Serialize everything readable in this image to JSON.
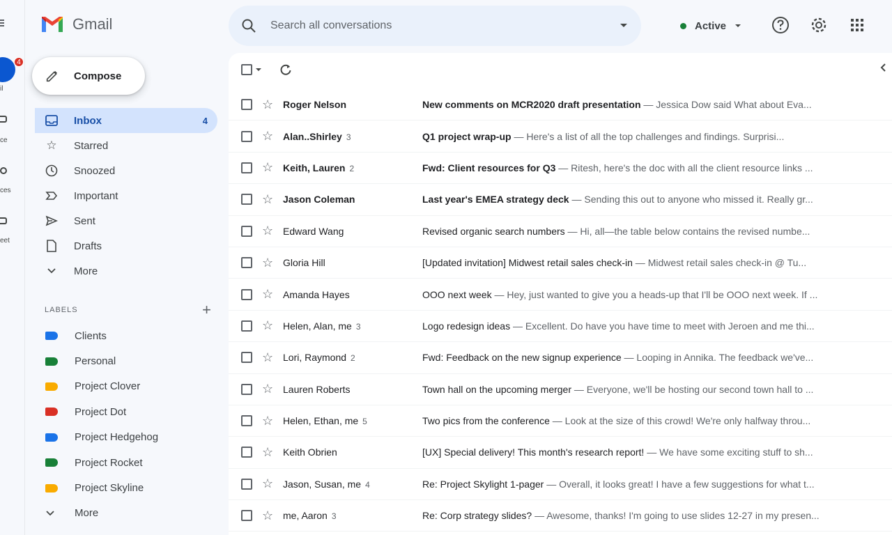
{
  "app": {
    "name": "Gmail"
  },
  "rail": {
    "badge": "4",
    "labels": [
      "il",
      "ce",
      "ces",
      "eet"
    ]
  },
  "compose": {
    "label": "Compose"
  },
  "nav": [
    {
      "label": "Inbox",
      "icon": "inbox-icon",
      "count": "4",
      "active": true
    },
    {
      "label": "Starred",
      "icon": "star-icon"
    },
    {
      "label": "Snoozed",
      "icon": "clock-icon"
    },
    {
      "label": "Important",
      "icon": "important-icon"
    },
    {
      "label": "Sent",
      "icon": "send-icon"
    },
    {
      "label": "Drafts",
      "icon": "draft-icon"
    },
    {
      "label": "More",
      "icon": "chevron-down-icon"
    }
  ],
  "labels_section": {
    "title": "LABELS",
    "items": [
      {
        "label": "Clients",
        "color": "#1a73e8"
      },
      {
        "label": "Personal",
        "color": "#188038"
      },
      {
        "label": "Project Clover",
        "color": "#f9ab00"
      },
      {
        "label": "Project Dot",
        "color": "#d93025"
      },
      {
        "label": "Project Hedgehog",
        "color": "#1a73e8"
      },
      {
        "label": "Project Rocket",
        "color": "#188038"
      },
      {
        "label": "Project Skyline",
        "color": "#f9ab00"
      },
      {
        "label": "More",
        "color": ""
      }
    ]
  },
  "search": {
    "placeholder": "Search all conversations"
  },
  "status": {
    "label": "Active"
  },
  "emails": [
    {
      "sender": "Roger Nelson",
      "count": "",
      "subject": "New comments on MCR2020 draft presentation",
      "snippet": " — Jessica Dow said What about Eva...",
      "unread": true
    },
    {
      "sender": "Alan..Shirley",
      "count": "3",
      "subject": "Q1 project wrap-up",
      "snippet": " — Here's a list of all the top challenges and findings. Surprisi...",
      "unread": true
    },
    {
      "sender": "Keith, Lauren",
      "count": "2",
      "subject": "Fwd: Client resources for Q3",
      "snippet": " — Ritesh, here's the doc with all the client resource links ...",
      "unread": true
    },
    {
      "sender": "Jason Coleman",
      "count": "",
      "subject": "Last year's EMEA strategy deck",
      "snippet": " — Sending this out to anyone who missed it. Really gr...",
      "unread": true
    },
    {
      "sender": "Edward Wang",
      "count": "",
      "subject": "Revised organic search numbers",
      "snippet": " — Hi, all—the table below contains the revised numbe...",
      "unread": false
    },
    {
      "sender": "Gloria Hill",
      "count": "",
      "subject": "[Updated invitation] Midwest retail sales check-in",
      "snippet": " — Midwest retail sales check-in @ Tu...",
      "unread": false
    },
    {
      "sender": "Amanda Hayes",
      "count": "",
      "subject": "OOO next week",
      "snippet": " — Hey, just wanted to give you a heads-up that I'll be OOO next week. If ...",
      "unread": false
    },
    {
      "sender": "Helen, Alan, me",
      "count": "3",
      "subject": "Logo redesign ideas",
      "snippet": " — Excellent. Do have you have time to meet with Jeroen and me thi...",
      "unread": false
    },
    {
      "sender": "Lori, Raymond",
      "count": "2",
      "subject": "Fwd: Feedback on the new signup experience",
      "snippet": " — Looping in Annika. The feedback we've...",
      "unread": false
    },
    {
      "sender": "Lauren Roberts",
      "count": "",
      "subject": "Town hall on the upcoming merger",
      "snippet": " — Everyone, we'll be hosting our second town hall to ...",
      "unread": false
    },
    {
      "sender": "Helen, Ethan, me",
      "count": "5",
      "subject": "Two pics from the conference",
      "snippet": " — Look at the size of this crowd! We're only halfway throu...",
      "unread": false
    },
    {
      "sender": "Keith Obrien",
      "count": "",
      "subject": "[UX] Special delivery! This month's research report!",
      "snippet": " — We have some exciting stuff to sh...",
      "unread": false
    },
    {
      "sender": "Jason, Susan, me",
      "count": "4",
      "subject": "Re: Project Skylight 1-pager",
      "snippet": " — Overall, it looks great! I have a few suggestions for what t...",
      "unread": false
    },
    {
      "sender": "me, Aaron",
      "count": "3",
      "subject": "Re: Corp strategy slides?",
      "snippet": " — Awesome, thanks! I'm going to use slides 12-27 in my presen...",
      "unread": false
    }
  ],
  "colors": {
    "accent": "#0b57d0",
    "active_nav": "#d3e3fd",
    "search_bg": "#eaf1fb",
    "active_status": "#188038"
  }
}
